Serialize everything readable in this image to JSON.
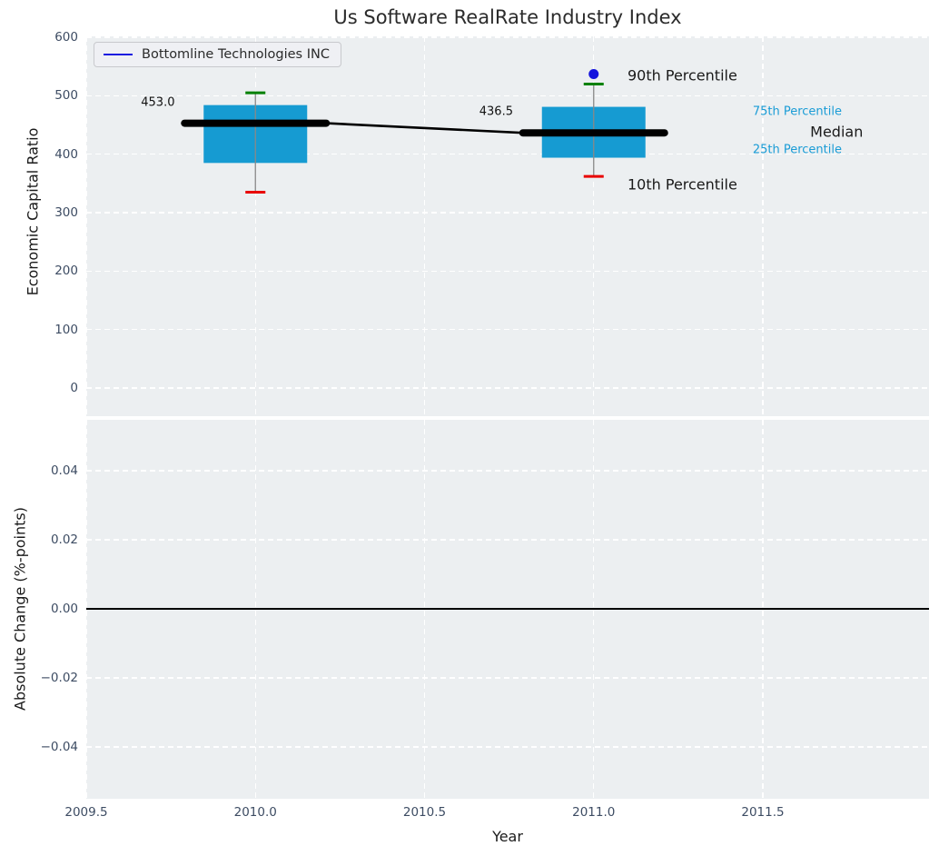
{
  "title": "Us Software RealRate Industry Index",
  "xlabel": "Year",
  "legend": {
    "label": "Bottomline Technologies INC",
    "line_color": "#1b1be0"
  },
  "colors": {
    "plot_background": "#eceff1",
    "grid": "#ffffff",
    "box_fill": "#169bd2",
    "p90_cap": "#008000",
    "p10_cap": "#e80000",
    "whisker": "#888888",
    "company_line": "#000000",
    "dot": "#1414dd",
    "tick_text": "#3d4c63",
    "annotation_blue": "#1a9cd6",
    "annotation_dark": "#1a1a1a"
  },
  "chart_data": [
    {
      "type": "boxplot",
      "title": "Us Software RealRate Industry Index",
      "ylabel": "Economic Capital Ratio",
      "ylim": [
        -48,
        602
      ],
      "yticks": [
        600,
        500,
        400,
        300,
        200,
        100,
        0
      ],
      "ytick_labels": [
        "600",
        "500",
        "400",
        "300",
        "200",
        "100",
        "0"
      ],
      "xlim": [
        2009.5,
        2011.99
      ],
      "xticks": [
        2009.5,
        2010.0,
        2010.5,
        2011.0,
        2011.5
      ],
      "xtick_labels": [
        "2009.5",
        "2010.0",
        "2010.5",
        "2011.0",
        "2011.5"
      ],
      "grid": true,
      "legend_position": "upper left",
      "boxes": [
        {
          "year": 2010,
          "p10": 335,
          "p25": 385,
          "median": 453,
          "p75": 484,
          "p90": 505,
          "value_label": "453.0"
        },
        {
          "year": 2011,
          "p10": 362,
          "p25": 394,
          "median": 436.5,
          "p75": 481,
          "p90": 520,
          "value_label": "436.5"
        }
      ],
      "series": [
        {
          "name": "Bottomline Technologies INC",
          "x": [
            2010,
            2011
          ],
          "values": [
            453.0,
            436.5
          ]
        }
      ],
      "outlier_dot": {
        "x": 2011,
        "y": 537
      },
      "annotations": [
        {
          "text": "90th Percentile",
          "x": 2011.1,
          "y": 535,
          "style": "lg"
        },
        {
          "text": "75th Percentile",
          "x": 2011.47,
          "y": 473,
          "style": "sm"
        },
        {
          "text": "Median",
          "x": 2011.64,
          "y": 438,
          "style": "lg"
        },
        {
          "text": "25th Percentile",
          "x": 2011.47,
          "y": 406.5,
          "style": "sm"
        },
        {
          "text": "10th Percentile",
          "x": 2011.1,
          "y": 348,
          "style": "lg"
        }
      ]
    },
    {
      "type": "line",
      "ylabel": "Absolute Change (%-points)",
      "ylim": [
        -0.055,
        0.055
      ],
      "yticks": [
        0.04,
        0.02,
        0.0,
        -0.02,
        -0.04
      ],
      "ytick_labels": [
        "0.04",
        "0.02",
        "0.00",
        "−0.02",
        "−0.04"
      ],
      "xlim": [
        2009.5,
        2011.99
      ],
      "xticks": [
        2009.5,
        2010.0,
        2010.5,
        2011.0,
        2011.5
      ],
      "xtick_labels": [
        "2009.5",
        "2010.0",
        "2010.5",
        "2011.0",
        "2011.5"
      ],
      "grid": true,
      "zero_line": 0.0,
      "series": []
    }
  ]
}
